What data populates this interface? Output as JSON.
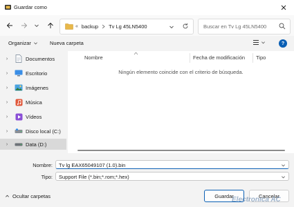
{
  "window": {
    "title": "Guardar como"
  },
  "address": {
    "crumbs": [
      "backup",
      "Tv Lg 45LN5400"
    ],
    "overflow": "«"
  },
  "search": {
    "placeholder": "Buscar en Tv Lg 45LN5400"
  },
  "toolbar": {
    "organize": "Organizar",
    "new_folder": "Nueva carpeta",
    "help": "?"
  },
  "sidebar": {
    "items": [
      {
        "label": "Documentos",
        "icon": "documents-icon",
        "selected": false
      },
      {
        "label": "Escritorio",
        "icon": "desktop-icon",
        "selected": false
      },
      {
        "label": "Imágenes",
        "icon": "pictures-icon",
        "selected": false
      },
      {
        "label": "Música",
        "icon": "music-icon",
        "selected": false
      },
      {
        "label": "Vídeos",
        "icon": "videos-icon",
        "selected": false
      },
      {
        "label": "Disco local (C:)",
        "icon": "local-disk-icon",
        "selected": false
      },
      {
        "label": "Data (D:)",
        "icon": "drive-icon",
        "selected": true
      }
    ]
  },
  "columns": {
    "name": "Nombre",
    "modified": "Fecha de modificación",
    "type": "Tipo"
  },
  "content": {
    "empty_message": "Ningún elemento coincide con el criterio de búsqueda."
  },
  "form": {
    "name_label": "Nombre:",
    "name_value": "Tv lg EAX65049107 (1.0).bin",
    "type_label": "Tipo:",
    "type_value": "Support File (*.bin;*.rom;*.hex)"
  },
  "footer": {
    "hide_folders": "Ocultar carpetas",
    "save": "Guardar",
    "cancel": "Cancelar"
  },
  "watermark": "Electronica AC",
  "colors": {
    "accent": "#0a5fb4",
    "folder": "#e8b84a",
    "background": "#f3f3f3"
  }
}
